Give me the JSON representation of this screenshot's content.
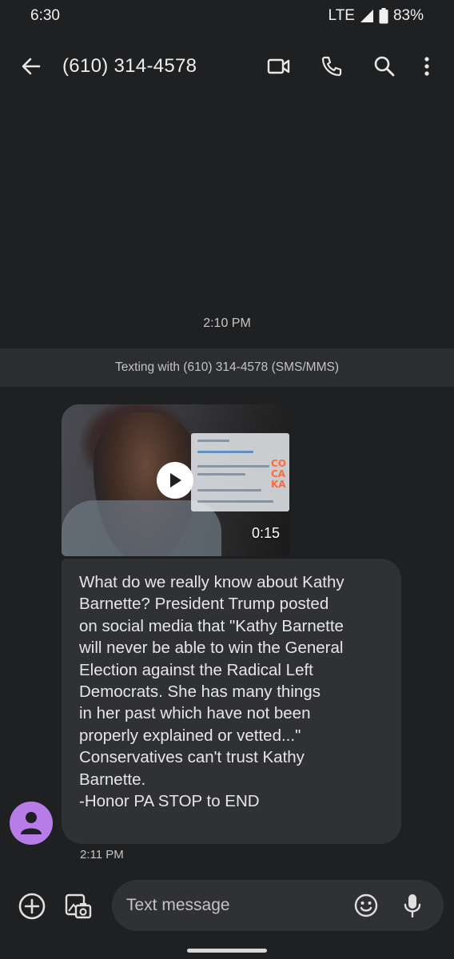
{
  "status_bar": {
    "time": "6:30",
    "network": "LTE",
    "battery": "83%"
  },
  "app_bar": {
    "title": "(610) 314-4578"
  },
  "conversation": {
    "date_label": "2:10 PM",
    "info_banner": "Texting with (610) 314-4578 (SMS/MMS)",
    "video": {
      "duration": "0:15",
      "sign_text": "CO\nCA\nKA"
    },
    "message": {
      "text": "What do we really know about Kathy\nBarnette?  President Trump posted\non social media that \"Kathy Barnette\nwill never be able to win the General\nElection against the Radical Left\nDemocrats. She has many things\nin her past which have not been\nproperly explained or vetted...\"\nConservatives can't trust Kathy\nBarnette.\n-Honor PA  STOP to END",
      "time": "2:11 PM"
    },
    "avatar_color": "#b87ce8"
  },
  "compose": {
    "placeholder": "Text message"
  },
  "icons": {
    "back": "arrow-left-icon",
    "video_call": "video-camera-icon",
    "call": "phone-icon",
    "search": "search-icon",
    "more": "more-vert-icon",
    "add": "add-circle-icon",
    "gallery": "gallery-camera-icon",
    "emoji": "emoji-icon",
    "mic": "mic-icon"
  },
  "colors": {
    "background": "#1f2022",
    "bubble": "#303134",
    "banner": "#2b2d30"
  }
}
